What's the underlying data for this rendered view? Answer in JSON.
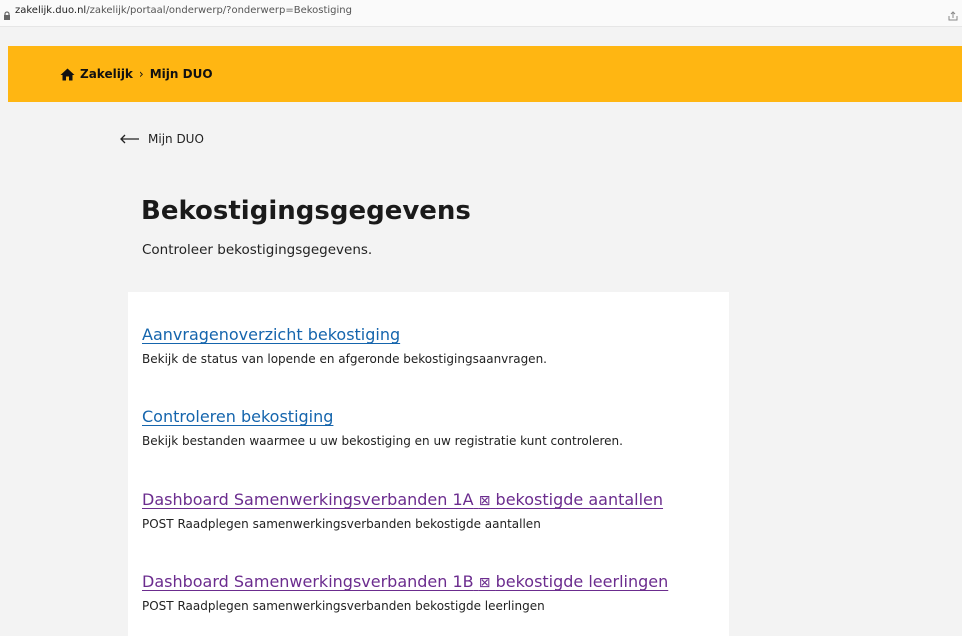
{
  "browser": {
    "url_domain": "zakelijk.duo.nl",
    "url_path": "/zakelijk/portaal/onderwerp/?onderwerp=Bekostiging"
  },
  "breadcrumb": {
    "home": "Zakelijk",
    "separator": "›",
    "current": "Mijn DUO"
  },
  "back_link": "Mijn DUO",
  "page": {
    "title": "Bekostigingsgegevens",
    "subtitle": "Controleer bekostigingsgegevens."
  },
  "items": [
    {
      "link": "Aanvragenoverzicht bekostiging",
      "desc": "Bekijk de status van lopende en afgeronde bekostigingsaanvragen."
    },
    {
      "link": "Controleren bekostiging",
      "desc": "Bekijk bestanden waarmee u uw bekostiging en uw registratie kunt controleren."
    },
    {
      "link_pre": "Dashboard Samenwerkingsverbanden 1A",
      "link_post": "bekostigde aantallen",
      "desc": "POST Raadplegen samenwerkingsverbanden bekostigde aantallen"
    },
    {
      "link_pre": "Dashboard Samenwerkingsverbanden 1B",
      "link_post": "bekostigde leerlingen",
      "desc": "POST Raadplegen samenwerkingsverbanden bekostigde leerlingen"
    }
  ],
  "ext_glyph": "⊠",
  "colors": {
    "header_band": "#ffb612",
    "link": "#1565ad",
    "visited_link": "#6b2c8e",
    "page_bg": "#f3f3f3"
  },
  "icons": [
    "lock-icon",
    "share-icon",
    "home-icon",
    "arrow-left-icon",
    "external-link-icon"
  ]
}
